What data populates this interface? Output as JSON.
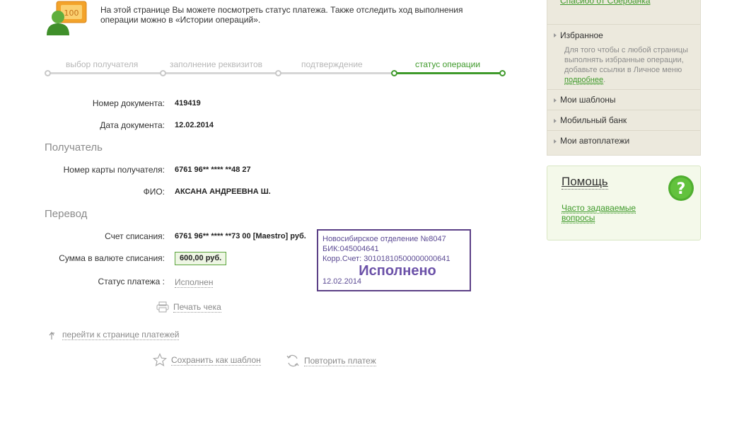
{
  "intro": {
    "text_line1": "На этой странице Вы можете посмотреть статус платежа. Также отследить ход выполнения",
    "text_line2": "операции можно в «Истории операций»."
  },
  "steps": [
    {
      "label": "выбор получателя",
      "active": false
    },
    {
      "label": "заполнение реквизитов",
      "active": false
    },
    {
      "label": "подтверждение",
      "active": false
    },
    {
      "label": "статус операции",
      "active": true
    }
  ],
  "document": {
    "number_label": "Номер документа:",
    "number_value": "419419",
    "date_label": "Дата документа:",
    "date_value": "12.02.2014"
  },
  "recipient": {
    "section_title": "Получатель",
    "card_label": "Номер карты получателя:",
    "card_value": "6761 96** **** **48 27",
    "name_label": "ФИО:",
    "name_value": "АКСАНА АНДРЕЕВНА Ш."
  },
  "transfer": {
    "section_title": "Перевод",
    "account_label": "Счет списания:",
    "account_value": "6761 96** **** **73 00  [Maestro]  руб.",
    "amount_label": "Сумма в валюте списания:",
    "amount_value": "600,00  руб.",
    "status_label": "Статус платежа :",
    "status_value": "Исполнен"
  },
  "stamp": {
    "line1": "Новосибирское отделение №8047",
    "line2": "БИК:045004641",
    "line3": "Корр.Счет: 30101810500000000641",
    "status": "Исполнено",
    "date": "12.02.2014",
    "color": "#5b3f86"
  },
  "actions": {
    "print_label": "Печать чека",
    "back_label": "перейти к странице платежей",
    "save_template_label": "Сохранить как шаблон",
    "repeat_label": "Повторить платеж"
  },
  "sidebar": {
    "top_link": "Спасибо от Сбербанка",
    "favorites": {
      "title": "Избранное",
      "desc": "Для того чтобы с любой страницы выполнять избранные операции, добавьте ссылки в Личное меню",
      "more": "подробнее",
      "more_suffix": "."
    },
    "items": [
      {
        "label": "Мои шаблоны"
      },
      {
        "label": "Мобильный банк"
      },
      {
        "label": "Мои автоплатежи"
      }
    ]
  },
  "help": {
    "title": "Помощь",
    "faq_label": "Часто задаваемые вопросы"
  },
  "colors": {
    "accent_green": "#3f9a2b",
    "inactive_gray": "#b7b7b7",
    "sidebar_bg": "#ece9dd"
  }
}
